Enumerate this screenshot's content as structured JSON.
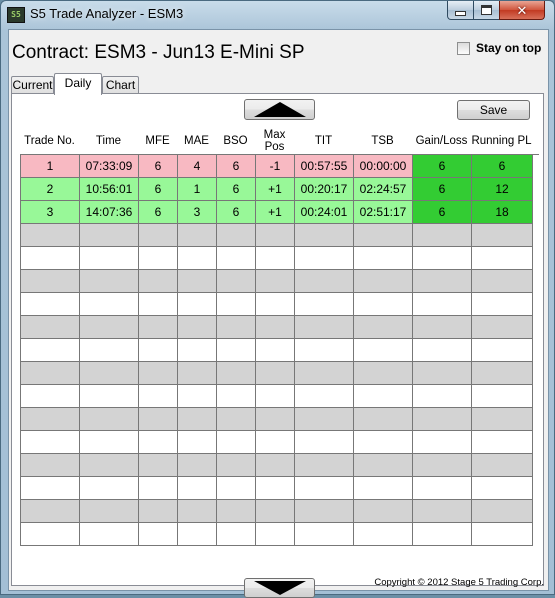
{
  "window": {
    "title": "S5 Trade Analyzer - ESM3",
    "app_icon_text": "S5",
    "close_glyph": "✕"
  },
  "header": {
    "contract_title": "Contract: ESM3 - Jun13 E-Mini SP",
    "stay_on_top_label": "Stay on top",
    "stay_on_top_checked": false
  },
  "tabs": [
    {
      "label": "Current"
    },
    {
      "label": "Daily"
    },
    {
      "label": "Chart"
    }
  ],
  "active_tab": "Daily",
  "toolbar": {
    "save_label": "Save",
    "scroll_up_icon": "triangle-up-icon",
    "scroll_down_icon": "triangle-down-icon"
  },
  "table": {
    "columns": [
      "Trade No.",
      "Time",
      "MFE",
      "MAE",
      "BSO",
      "Max\nPos",
      "TIT",
      "TSB",
      "Gain/Loss",
      "Running PL"
    ],
    "rows": [
      {
        "cells": [
          "1",
          "07:33:09",
          "6",
          "4",
          "6",
          "-1",
          "00:57:55",
          "00:00:00",
          "6",
          "6"
        ],
        "status": "loss-first"
      },
      {
        "cells": [
          "2",
          "10:56:01",
          "6",
          "1",
          "6",
          "+1",
          "00:20:17",
          "02:24:57",
          "6",
          "12"
        ],
        "status": "win"
      },
      {
        "cells": [
          "3",
          "14:07:36",
          "6",
          "3",
          "6",
          "+1",
          "00:24:01",
          "02:51:17",
          "6",
          "18"
        ],
        "status": "win"
      }
    ],
    "empty_row_count": 14
  },
  "colors": {
    "row_pink": "#f8b9c2",
    "row_light_green": "#98f898",
    "gain_dark_green": "#33cc33",
    "empty_gray": "#d3d3d3"
  },
  "footer": {
    "copyright": "Copyright © 2012 Stage 5 Trading Corp."
  }
}
